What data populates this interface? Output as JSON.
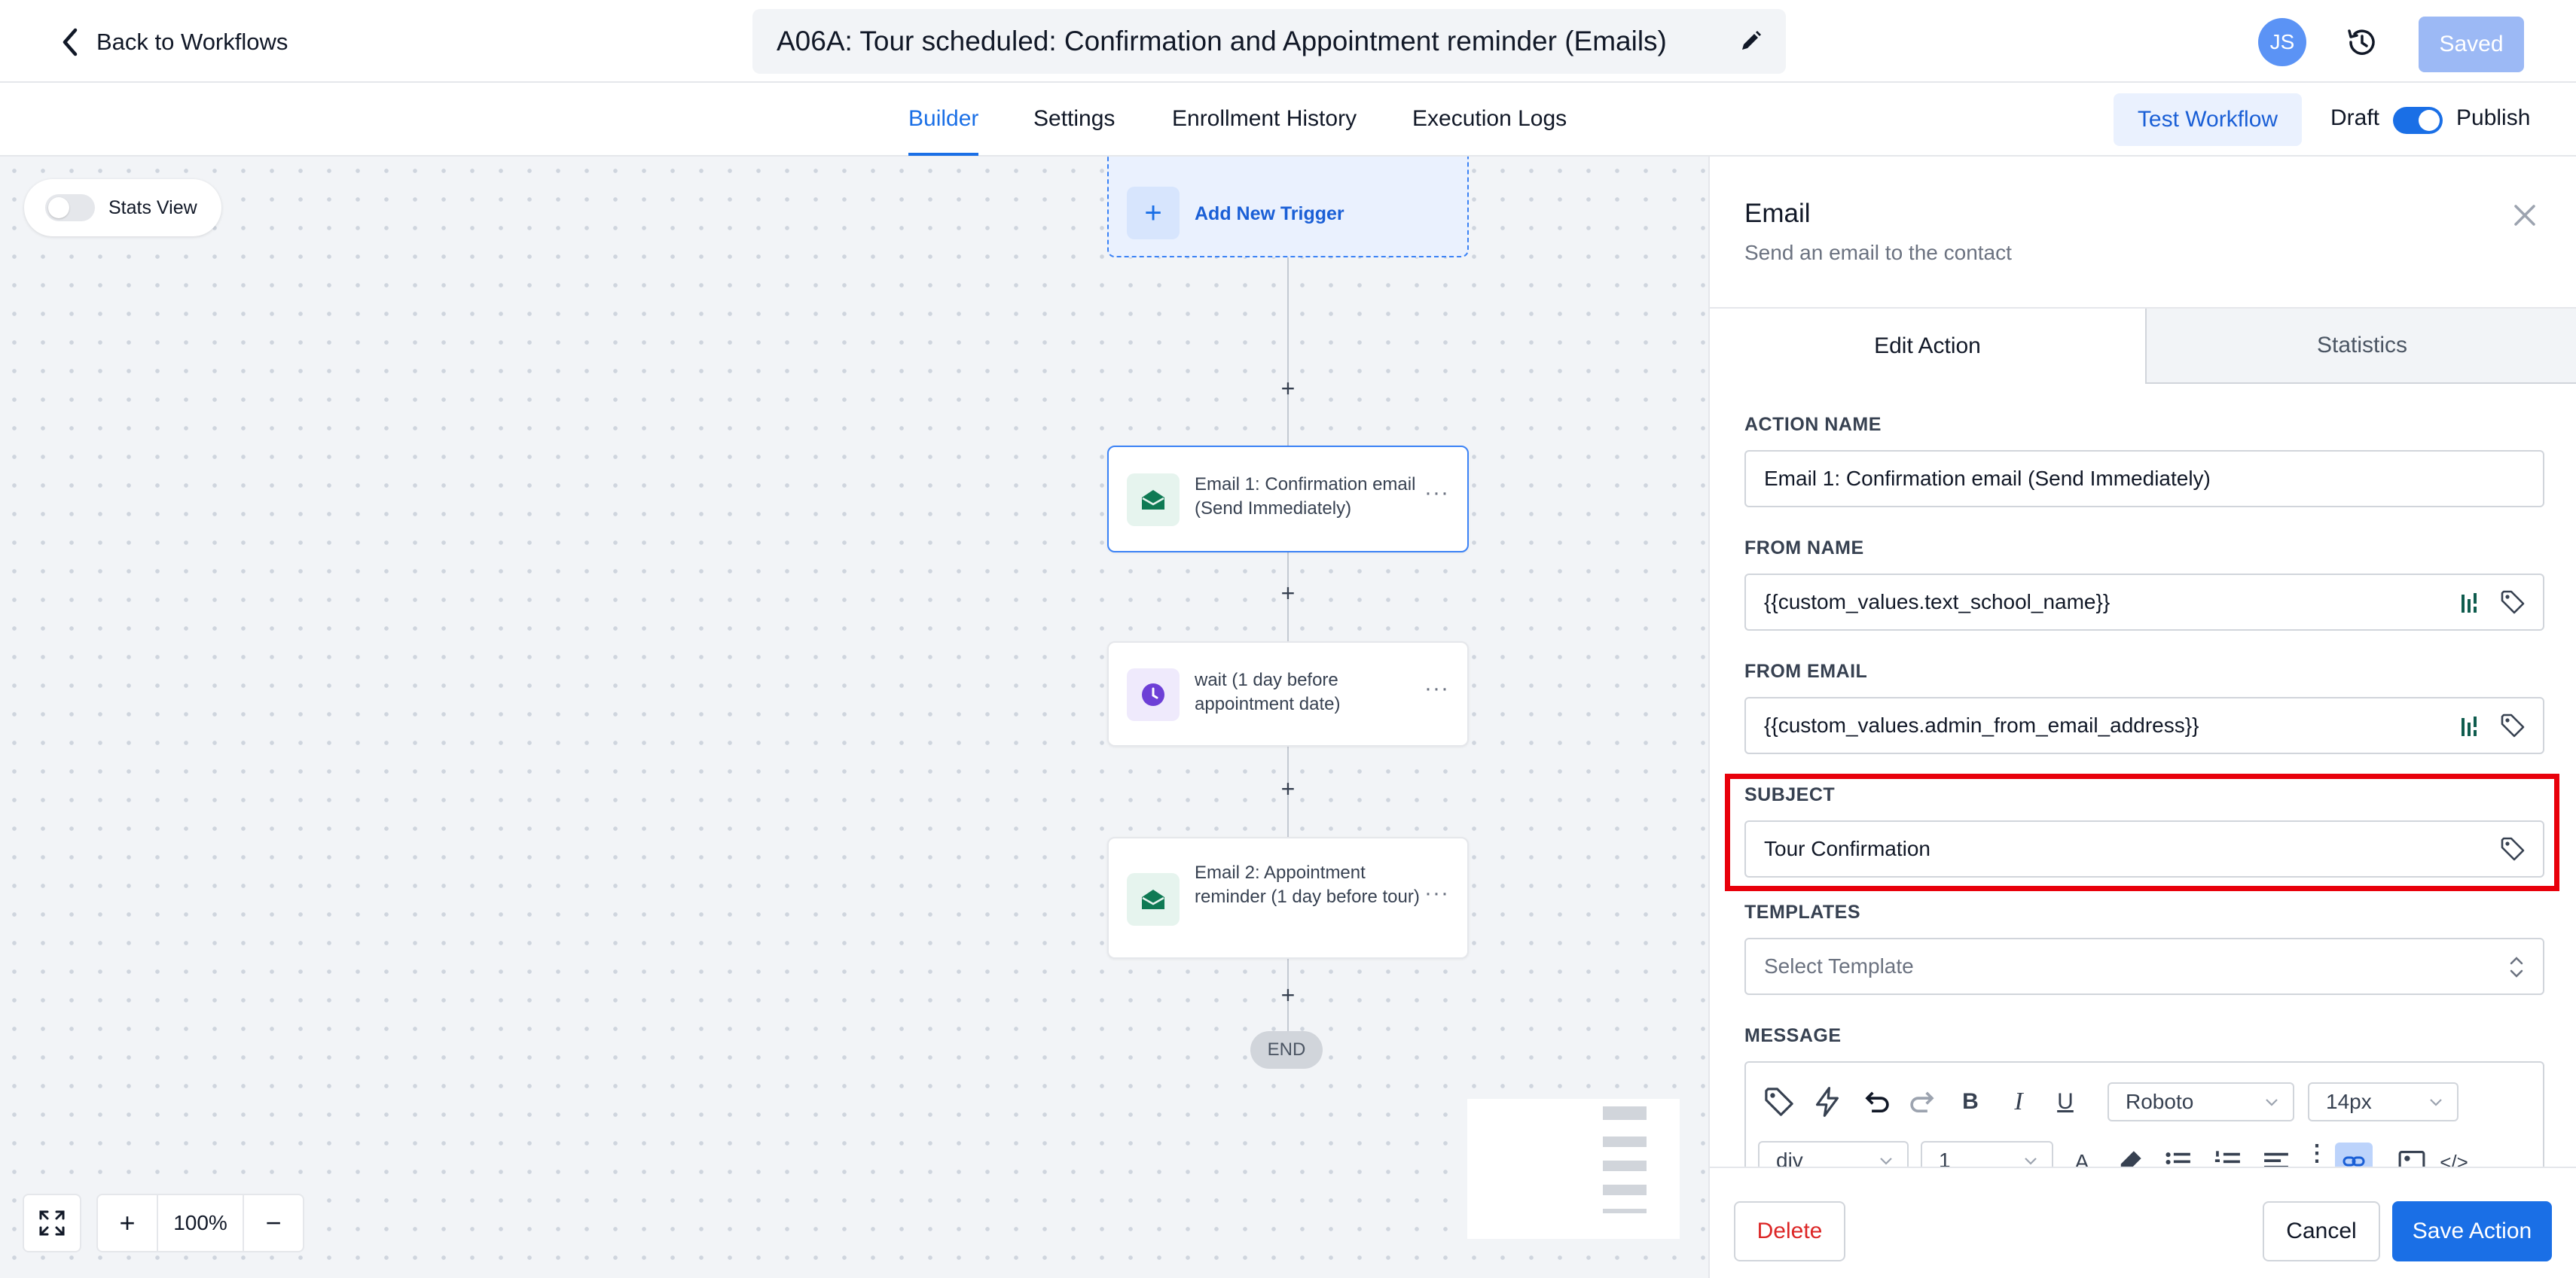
{
  "header": {
    "back_label": "Back to Workflows",
    "workflow_title": "A06A: Tour scheduled: Confirmation and Appointment reminder (Emails)",
    "avatar_initials": "JS",
    "saved_label": "Saved"
  },
  "nav": {
    "tabs": [
      {
        "label": "Builder",
        "active": true
      },
      {
        "label": "Settings",
        "active": false
      },
      {
        "label": "Enrollment History",
        "active": false
      },
      {
        "label": "Execution Logs",
        "active": false
      }
    ],
    "test_workflow_label": "Test Workflow",
    "draft_label": "Draft",
    "publish_label": "Publish",
    "publish_on": true
  },
  "canvas": {
    "stats_view_label": "Stats View",
    "stats_view_on": false,
    "trigger_label": "Add New Trigger",
    "nodes": [
      {
        "label": "Email 1: Confirmation email (Send Immediately)",
        "icon": "email-icon",
        "selected": true
      },
      {
        "label": "wait (1 day before appointment date)",
        "icon": "clock-icon",
        "selected": false
      },
      {
        "label": "Email 2: Appointment reminder (1 day before tour)",
        "icon": "email-icon",
        "selected": false
      }
    ],
    "end_label": "END",
    "zoom_level": "100%"
  },
  "panel": {
    "title": "Email",
    "subtitle": "Send an email to the contact",
    "tabs": [
      "Edit Action",
      "Statistics"
    ],
    "fields": {
      "action_name": {
        "label": "ACTION NAME",
        "value": "Email 1: Confirmation email (Send Immediately)"
      },
      "from_name": {
        "label": "FROM NAME",
        "value": "{{custom_values.text_school_name}}"
      },
      "from_email": {
        "label": "FROM EMAIL",
        "value": "{{custom_values.admin_from_email_address}}"
      },
      "subject": {
        "label": "SUBJECT",
        "value": "Tour Confirmation"
      },
      "templates": {
        "label": "TEMPLATES",
        "placeholder": "Select Template"
      },
      "message": {
        "label": "MESSAGE"
      }
    },
    "editor": {
      "font_family": "Roboto",
      "font_size": "14px",
      "block_type": "div",
      "line_height": "1"
    },
    "footer": {
      "delete_label": "Delete",
      "cancel_label": "Cancel",
      "save_label": "Save Action"
    }
  },
  "colors": {
    "accent": "#1a6fe6",
    "highlight": "#e8000b",
    "email_icon": "#0f7a54",
    "wait_icon": "#6d3fd6",
    "danger": "#dc2626"
  }
}
